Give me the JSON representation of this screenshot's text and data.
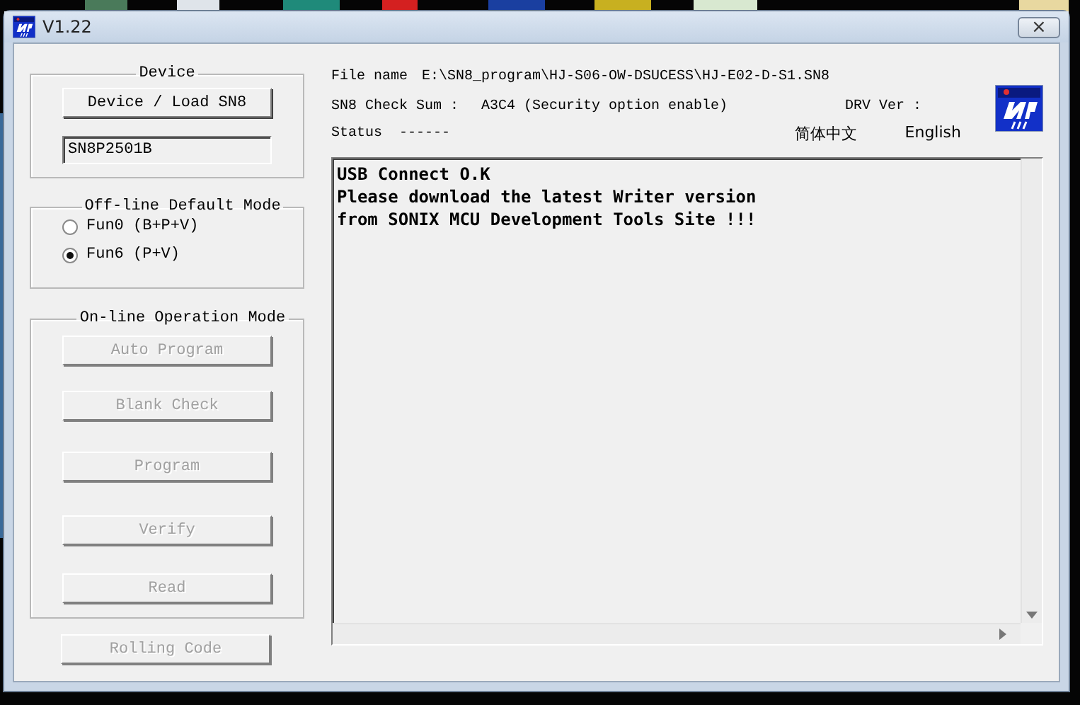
{
  "window": {
    "title": "V1.22",
    "close": "×"
  },
  "device": {
    "title": "Device",
    "button": "Device / Load SN8",
    "chip": "SN8P2501B"
  },
  "offline": {
    "title": "Off-line Default Mode",
    "options": [
      {
        "label": "Fun0 (B+P+V)",
        "selected": false
      },
      {
        "label": "Fun6 (P+V)",
        "selected": true
      }
    ]
  },
  "online": {
    "title": "On-line Operation Mode",
    "buttons": [
      {
        "label": "Auto Program",
        "disabled": true
      },
      {
        "label": "Blank Check",
        "disabled": true
      },
      {
        "label": "Program",
        "disabled": true
      },
      {
        "label": "Verify",
        "disabled": true
      },
      {
        "label": "Read",
        "disabled": true
      }
    ]
  },
  "rolling_code": {
    "label": "Rolling Code",
    "disabled": true
  },
  "info": {
    "file_name_label": "File name",
    "file_name": "E:\\SN8_program\\HJ-S06-OW-DSUCESS\\HJ-E02-D-S1.SN8",
    "checksum_label": "SN8 Check Sum :",
    "checksum": "A3C4 (Security option enable)",
    "drv_label": "DRV Ver :",
    "status_label": "Status",
    "status": "------",
    "languages": [
      {
        "label": "简体中文"
      },
      {
        "label": "English"
      }
    ]
  },
  "log": [
    "USB Connect O.K",
    "Please download the latest Writer version",
    "from SONIX MCU Development Tools Site !!!"
  ]
}
